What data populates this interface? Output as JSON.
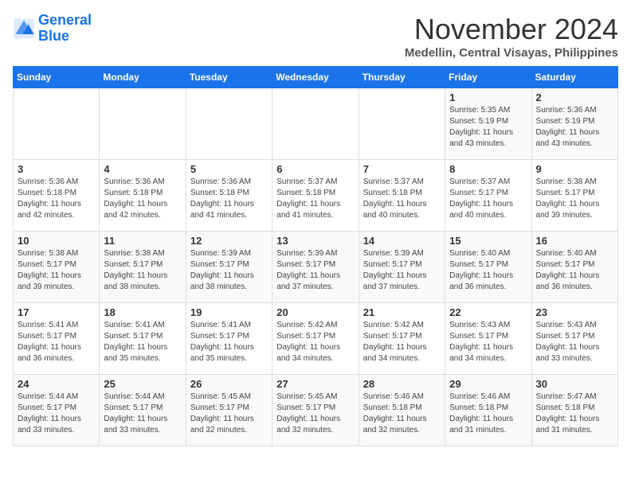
{
  "logo": {
    "line1": "General",
    "line2": "Blue"
  },
  "title": "November 2024",
  "location": "Medellin, Central Visayas, Philippines",
  "days_header": [
    "Sunday",
    "Monday",
    "Tuesday",
    "Wednesday",
    "Thursday",
    "Friday",
    "Saturday"
  ],
  "weeks": [
    [
      {
        "day": "",
        "info": ""
      },
      {
        "day": "",
        "info": ""
      },
      {
        "day": "",
        "info": ""
      },
      {
        "day": "",
        "info": ""
      },
      {
        "day": "",
        "info": ""
      },
      {
        "day": "1",
        "info": "Sunrise: 5:35 AM\nSunset: 5:19 PM\nDaylight: 11 hours and 43 minutes."
      },
      {
        "day": "2",
        "info": "Sunrise: 5:36 AM\nSunset: 5:19 PM\nDaylight: 11 hours and 43 minutes."
      }
    ],
    [
      {
        "day": "3",
        "info": "Sunrise: 5:36 AM\nSunset: 5:18 PM\nDaylight: 11 hours and 42 minutes."
      },
      {
        "day": "4",
        "info": "Sunrise: 5:36 AM\nSunset: 5:18 PM\nDaylight: 11 hours and 42 minutes."
      },
      {
        "day": "5",
        "info": "Sunrise: 5:36 AM\nSunset: 5:18 PM\nDaylight: 11 hours and 41 minutes."
      },
      {
        "day": "6",
        "info": "Sunrise: 5:37 AM\nSunset: 5:18 PM\nDaylight: 11 hours and 41 minutes."
      },
      {
        "day": "7",
        "info": "Sunrise: 5:37 AM\nSunset: 5:18 PM\nDaylight: 11 hours and 40 minutes."
      },
      {
        "day": "8",
        "info": "Sunrise: 5:37 AM\nSunset: 5:17 PM\nDaylight: 11 hours and 40 minutes."
      },
      {
        "day": "9",
        "info": "Sunrise: 5:38 AM\nSunset: 5:17 PM\nDaylight: 11 hours and 39 minutes."
      }
    ],
    [
      {
        "day": "10",
        "info": "Sunrise: 5:38 AM\nSunset: 5:17 PM\nDaylight: 11 hours and 39 minutes."
      },
      {
        "day": "11",
        "info": "Sunrise: 5:38 AM\nSunset: 5:17 PM\nDaylight: 11 hours and 38 minutes."
      },
      {
        "day": "12",
        "info": "Sunrise: 5:39 AM\nSunset: 5:17 PM\nDaylight: 11 hours and 38 minutes."
      },
      {
        "day": "13",
        "info": "Sunrise: 5:39 AM\nSunset: 5:17 PM\nDaylight: 11 hours and 37 minutes."
      },
      {
        "day": "14",
        "info": "Sunrise: 5:39 AM\nSunset: 5:17 PM\nDaylight: 11 hours and 37 minutes."
      },
      {
        "day": "15",
        "info": "Sunrise: 5:40 AM\nSunset: 5:17 PM\nDaylight: 11 hours and 36 minutes."
      },
      {
        "day": "16",
        "info": "Sunrise: 5:40 AM\nSunset: 5:17 PM\nDaylight: 11 hours and 36 minutes."
      }
    ],
    [
      {
        "day": "17",
        "info": "Sunrise: 5:41 AM\nSunset: 5:17 PM\nDaylight: 11 hours and 36 minutes."
      },
      {
        "day": "18",
        "info": "Sunrise: 5:41 AM\nSunset: 5:17 PM\nDaylight: 11 hours and 35 minutes."
      },
      {
        "day": "19",
        "info": "Sunrise: 5:41 AM\nSunset: 5:17 PM\nDaylight: 11 hours and 35 minutes."
      },
      {
        "day": "20",
        "info": "Sunrise: 5:42 AM\nSunset: 5:17 PM\nDaylight: 11 hours and 34 minutes."
      },
      {
        "day": "21",
        "info": "Sunrise: 5:42 AM\nSunset: 5:17 PM\nDaylight: 11 hours and 34 minutes."
      },
      {
        "day": "22",
        "info": "Sunrise: 5:43 AM\nSunset: 5:17 PM\nDaylight: 11 hours and 34 minutes."
      },
      {
        "day": "23",
        "info": "Sunrise: 5:43 AM\nSunset: 5:17 PM\nDaylight: 11 hours and 33 minutes."
      }
    ],
    [
      {
        "day": "24",
        "info": "Sunrise: 5:44 AM\nSunset: 5:17 PM\nDaylight: 11 hours and 33 minutes."
      },
      {
        "day": "25",
        "info": "Sunrise: 5:44 AM\nSunset: 5:17 PM\nDaylight: 11 hours and 33 minutes."
      },
      {
        "day": "26",
        "info": "Sunrise: 5:45 AM\nSunset: 5:17 PM\nDaylight: 11 hours and 32 minutes."
      },
      {
        "day": "27",
        "info": "Sunrise: 5:45 AM\nSunset: 5:17 PM\nDaylight: 11 hours and 32 minutes."
      },
      {
        "day": "28",
        "info": "Sunrise: 5:46 AM\nSunset: 5:18 PM\nDaylight: 11 hours and 32 minutes."
      },
      {
        "day": "29",
        "info": "Sunrise: 5:46 AM\nSunset: 5:18 PM\nDaylight: 11 hours and 31 minutes."
      },
      {
        "day": "30",
        "info": "Sunrise: 5:47 AM\nSunset: 5:18 PM\nDaylight: 11 hours and 31 minutes."
      }
    ]
  ]
}
